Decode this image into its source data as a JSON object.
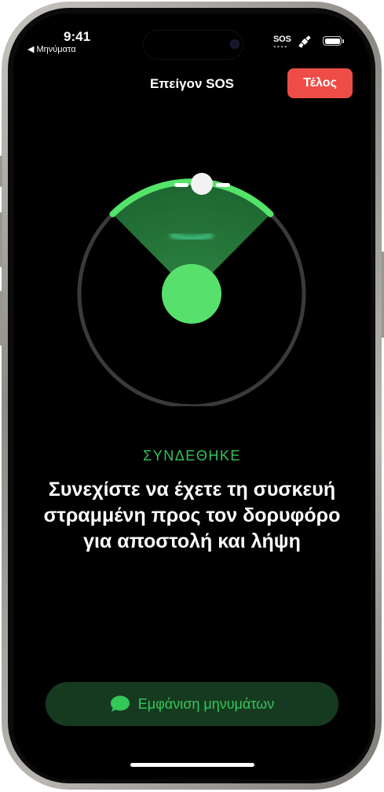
{
  "status_bar": {
    "time": "9:41",
    "back_label": "◀ Μηνύματα",
    "sos": "SOS",
    "sos_dots": "●●●●",
    "satellite_icon": "satellite-icon",
    "battery_icon": "battery-full-icon"
  },
  "nav": {
    "title": "Επείγον SOS",
    "done_label": "Τέλος"
  },
  "connection": {
    "status": "ΣΥΝΔΕΘΗΚΕ",
    "instruction": "Συνεχίστε να έχετε τη συσκευή στραμμένη προς τον δορυφόρο για αποστολή και λήψη"
  },
  "messages_button": {
    "label": "Εμφάνιση μηνυμάτων",
    "icon": "message-bubble-icon"
  },
  "colors": {
    "accent_green": "#34c759",
    "done_red": "#ee4d47",
    "ring_gray": "#3a3a3c",
    "button_dark_green": "#163a20"
  }
}
